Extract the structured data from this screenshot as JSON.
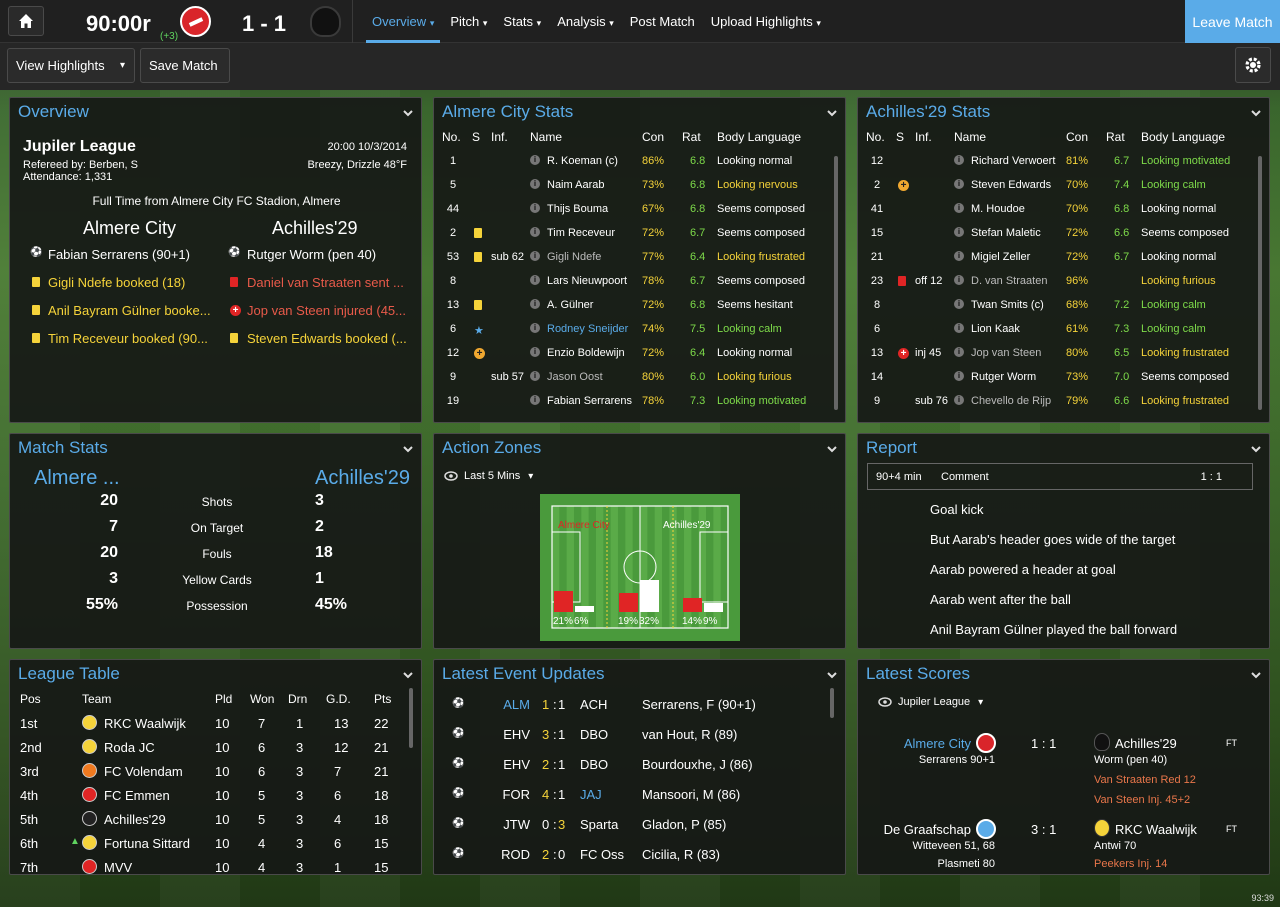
{
  "topbar": {
    "clock": "90:00r",
    "extra": "(+3)",
    "score": "1 - 1",
    "leave": "Leave Match",
    "nav": [
      "Overview",
      "Pitch",
      "Stats",
      "Analysis",
      "Post Match",
      "Upload Highlights"
    ]
  },
  "subbar": {
    "view_highlights": "View Highlights",
    "save_match": "Save Match"
  },
  "overview": {
    "title": "Overview",
    "league": "Jupiler League",
    "datetime": "20:00 10/3/2014",
    "referee": "Refereed by: Berben, S",
    "weather": "Breezy, Drizzle 48°F",
    "attendance": "Attendance: 1,331",
    "fulltime": "Full Time from Almere City FC Stadion, Almere",
    "home": "Almere City",
    "away": "Achilles'29",
    "home_events": [
      "Fabian Serrarens (90+1)",
      "Gigli Ndefe booked (18)",
      "Anil Bayram Gülner booke...",
      "Tim Receveur booked (90..."
    ],
    "away_events": [
      "Rutger Worm (pen 40)",
      "Daniel van Straaten sent ...",
      "Jop van Steen injured (45...",
      "Steven Edwards booked (..."
    ]
  },
  "home_stats": {
    "title": "Almere City Stats",
    "headers": [
      "No.",
      "S",
      "Inf.",
      "Name",
      "Con",
      "Rat",
      "Body Language"
    ],
    "rows": [
      {
        "no": "1",
        "inf": "",
        "name": "R. Koeman (c)",
        "con": "86%",
        "rat": "6.8",
        "bl": "Looking normal",
        "icon": "",
        "namecls": "",
        "blcls": ""
      },
      {
        "no": "5",
        "inf": "",
        "name": "Naim Aarab",
        "con": "73%",
        "rat": "6.8",
        "bl": "Looking nervous",
        "icon": "",
        "namecls": "",
        "blcls": "y"
      },
      {
        "no": "44",
        "inf": "",
        "name": "Thijs Bouma",
        "con": "67%",
        "rat": "6.8",
        "bl": "Seems composed",
        "icon": "",
        "namecls": "",
        "blcls": ""
      },
      {
        "no": "2",
        "inf": "",
        "name": "Tim Receveur",
        "con": "72%",
        "rat": "6.7",
        "bl": "Seems composed",
        "icon": "yellow",
        "namecls": "",
        "blcls": ""
      },
      {
        "no": "53",
        "inf": "sub 62",
        "name": "Gigli Ndefe",
        "con": "77%",
        "rat": "6.4",
        "bl": "Looking frustrated",
        "icon": "yellow",
        "namecls": "gr",
        "blcls": "y"
      },
      {
        "no": "8",
        "inf": "",
        "name": "Lars Nieuwpoort",
        "con": "78%",
        "rat": "6.7",
        "bl": "Seems composed",
        "icon": "",
        "namecls": "",
        "blcls": ""
      },
      {
        "no": "13",
        "inf": "",
        "name": "A. Gülner",
        "con": "72%",
        "rat": "6.8",
        "bl": "Seems hesitant",
        "icon": "yellow",
        "namecls": "",
        "blcls": ""
      },
      {
        "no": "6",
        "inf": "",
        "name": "Rodney Sneijder",
        "con": "74%",
        "rat": "7.5",
        "bl": "Looking calm",
        "icon": "star",
        "namecls": "b",
        "blcls": "g"
      },
      {
        "no": "12",
        "inf": "",
        "name": "Enzio Boldewijn",
        "con": "72%",
        "rat": "6.4",
        "bl": "Looking normal",
        "icon": "plus",
        "namecls": "",
        "blcls": ""
      },
      {
        "no": "9",
        "inf": "sub 57",
        "name": "Jason Oost",
        "con": "80%",
        "rat": "6.0",
        "bl": "Looking furious",
        "icon": "",
        "namecls": "gr",
        "blcls": "y"
      },
      {
        "no": "19",
        "inf": "",
        "name": "Fabian Serrarens",
        "con": "78%",
        "rat": "7.3",
        "bl": "Looking motivated",
        "icon": "",
        "namecls": "",
        "blcls": "g"
      }
    ]
  },
  "away_stats": {
    "title": "Achilles'29 Stats",
    "headers": [
      "No.",
      "S",
      "Inf.",
      "Name",
      "Con",
      "Rat",
      "Body Language"
    ],
    "rows": [
      {
        "no": "12",
        "inf": "",
        "name": "Richard Verwoert",
        "con": "81%",
        "rat": "6.7",
        "bl": "Looking motivated",
        "icon": "",
        "namecls": "",
        "blcls": "g"
      },
      {
        "no": "2",
        "inf": "",
        "name": "Steven Edwards",
        "con": "70%",
        "rat": "7.4",
        "bl": "Looking calm",
        "icon": "plus",
        "namecls": "",
        "blcls": "g"
      },
      {
        "no": "41",
        "inf": "",
        "name": "M. Houdoe",
        "con": "70%",
        "rat": "6.8",
        "bl": "Looking normal",
        "icon": "",
        "namecls": "",
        "blcls": ""
      },
      {
        "no": "15",
        "inf": "",
        "name": "Stefan Maletic",
        "con": "72%",
        "rat": "6.6",
        "bl": "Seems composed",
        "icon": "",
        "namecls": "",
        "blcls": ""
      },
      {
        "no": "21",
        "inf": "",
        "name": "Migiel Zeller",
        "con": "72%",
        "rat": "6.7",
        "bl": "Looking normal",
        "icon": "",
        "namecls": "",
        "blcls": ""
      },
      {
        "no": "23",
        "inf": "off 12",
        "name": "D. van Straaten",
        "con": "96%",
        "rat": "",
        "bl": "Looking furious",
        "icon": "red",
        "namecls": "gr",
        "blcls": "y"
      },
      {
        "no": "8",
        "inf": "",
        "name": "Twan Smits (c)",
        "con": "68%",
        "rat": "7.2",
        "bl": "Looking calm",
        "icon": "",
        "namecls": "",
        "blcls": "g"
      },
      {
        "no": "6",
        "inf": "",
        "name": "Lion Kaak",
        "con": "61%",
        "rat": "7.3",
        "bl": "Looking calm",
        "icon": "",
        "namecls": "",
        "blcls": "g"
      },
      {
        "no": "13",
        "inf": "inj 45",
        "name": "Jop van Steen",
        "con": "80%",
        "rat": "6.5",
        "bl": "Looking frustrated",
        "icon": "injury",
        "namecls": "gr",
        "blcls": "y"
      },
      {
        "no": "14",
        "inf": "",
        "name": "Rutger Worm",
        "con": "73%",
        "rat": "7.0",
        "bl": "Seems composed",
        "icon": "",
        "namecls": "",
        "blcls": ""
      },
      {
        "no": "9",
        "inf": "sub 76",
        "name": "Chevello de Rijp",
        "con": "79%",
        "rat": "6.6",
        "bl": "Looking frustrated",
        "icon": "",
        "namecls": "gr",
        "blcls": "y"
      }
    ]
  },
  "match_stats": {
    "title": "Match Stats",
    "home": "Almere ...",
    "away": "Achilles'29",
    "rows": [
      {
        "h": "20",
        "label": "Shots",
        "a": "3"
      },
      {
        "h": "7",
        "label": "On Target",
        "a": "2"
      },
      {
        "h": "20",
        "label": "Fouls",
        "a": "18"
      },
      {
        "h": "3",
        "label": "Yellow Cards",
        "a": "1"
      },
      {
        "h": "55%",
        "label": "Possession",
        "a": "45%"
      }
    ]
  },
  "action_zones": {
    "title": "Action Zones",
    "filter": "Last 5 Mins",
    "home": "Almere City",
    "away": "Achilles'29",
    "chart_data": {
      "type": "bar",
      "categories": [
        "Defensive third",
        "Middle third",
        "Attacking third"
      ],
      "series": [
        {
          "values": [
            21,
            19,
            14
          ]
        },
        {
          "values": [
            6,
            32,
            9
          ]
        }
      ],
      "labels": [
        "21%",
        "6%",
        "19%",
        "32%",
        "14%",
        "9%"
      ]
    }
  },
  "report": {
    "title": "Report",
    "time": "90+4 min",
    "col": "Comment",
    "score": "1 : 1",
    "lines": [
      "Goal kick",
      "But Aarab's header goes wide of the target",
      "Aarab powered a header at goal",
      "Aarab went after the ball",
      "Anil Bayram Gülner played the ball forward"
    ]
  },
  "league_table": {
    "title": "League Table",
    "headers": [
      "Pos",
      "Team",
      "Pld",
      "Won",
      "Drn",
      "G.D.",
      "Pts"
    ],
    "rows": [
      {
        "pos": "1st",
        "team": "RKC Waalwijk",
        "pld": "10",
        "won": "7",
        "drn": "1",
        "gd": "13",
        "pts": "22",
        "move": ""
      },
      {
        "pos": "2nd",
        "team": "Roda JC",
        "pld": "10",
        "won": "6",
        "drn": "3",
        "gd": "12",
        "pts": "21",
        "move": ""
      },
      {
        "pos": "3rd",
        "team": "FC Volendam",
        "pld": "10",
        "won": "6",
        "drn": "3",
        "gd": "7",
        "pts": "21",
        "move": ""
      },
      {
        "pos": "4th",
        "team": "FC Emmen",
        "pld": "10",
        "won": "5",
        "drn": "3",
        "gd": "6",
        "pts": "18",
        "move": ""
      },
      {
        "pos": "5th",
        "team": "Achilles'29",
        "pld": "10",
        "won": "5",
        "drn": "3",
        "gd": "4",
        "pts": "18",
        "move": ""
      },
      {
        "pos": "6th",
        "team": "Fortuna Sittard",
        "pld": "10",
        "won": "4",
        "drn": "3",
        "gd": "6",
        "pts": "15",
        "move": "up"
      },
      {
        "pos": "7th",
        "team": "MVV",
        "pld": "10",
        "won": "4",
        "drn": "3",
        "gd": "1",
        "pts": "15",
        "move": ""
      }
    ]
  },
  "events": {
    "title": "Latest Event Updates",
    "rows": [
      {
        "home": "ALM",
        "hs": "1",
        "as": "1",
        "away": "ACH",
        "scorer": "Serrarens, F (90+1)",
        "hcls": "b",
        "acls": "",
        "hscls": "y",
        "ascls": ""
      },
      {
        "home": "EHV",
        "hs": "3",
        "as": "1",
        "away": "DBO",
        "scorer": "van Hout, R (89)",
        "hcls": "",
        "acls": "",
        "hscls": "y",
        "ascls": ""
      },
      {
        "home": "EHV",
        "hs": "2",
        "as": "1",
        "away": "DBO",
        "scorer": "Bourdouxhe, J (86)",
        "hcls": "",
        "acls": "",
        "hscls": "y",
        "ascls": ""
      },
      {
        "home": "FOR",
        "hs": "4",
        "as": "1",
        "away": "JAJ",
        "scorer": "Mansoori, M (86)",
        "hcls": "",
        "acls": "b",
        "hscls": "y",
        "ascls": ""
      },
      {
        "home": "JTW",
        "hs": "0",
        "as": "3",
        "away": "Sparta",
        "scorer": "Gladon, P (85)",
        "hcls": "",
        "acls": "",
        "hscls": "",
        "ascls": "y"
      },
      {
        "home": "ROD",
        "hs": "2",
        "as": "0",
        "away": "FC Oss",
        "scorer": "Cicilia, R (83)",
        "hcls": "",
        "acls": "",
        "hscls": "y",
        "ascls": ""
      }
    ]
  },
  "scores": {
    "title": "Latest Scores",
    "filter": "Jupiler League",
    "games": [
      {
        "home": "Almere City",
        "score": "1 : 1",
        "away": "Achilles'29",
        "status": "FT",
        "home_detail": "Serrarens 90+1",
        "away_detail": [
          "Worm (pen 40)",
          "Van Straaten Red 12",
          "Van Steen Inj. 45+2"
        ]
      },
      {
        "home": "De Graafschap",
        "score": "3 : 1",
        "away": "RKC Waalwijk",
        "status": "FT",
        "home_detail": [
          "Witteveen 51, 68",
          "Plasmeti 80"
        ],
        "away_detail": [
          "Antwi 70",
          "Peekers Inj. 14"
        ]
      }
    ]
  },
  "footer": {
    "time": "93:39"
  }
}
